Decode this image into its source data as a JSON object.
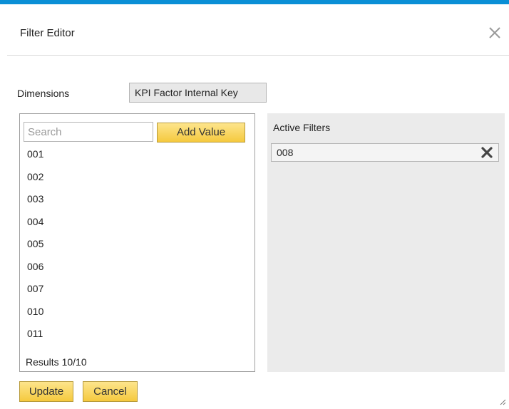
{
  "dialog": {
    "title": "Filter Editor",
    "close_icon": "close-icon"
  },
  "dimensions": {
    "label": "Dimensions",
    "selected": "KPI Factor Internal Key"
  },
  "values_panel": {
    "search_placeholder": "Search",
    "search_value": "",
    "add_button": "Add Value",
    "items": [
      "001",
      "002",
      "003",
      "004",
      "005",
      "006",
      "007",
      "010",
      "011"
    ],
    "results": "Results 10/10"
  },
  "active_filters": {
    "label": "Active Filters",
    "items": [
      {
        "value": "008",
        "remove_icon": "remove-x-icon"
      }
    ]
  },
  "footer": {
    "update_button": "Update",
    "cancel_button": "Cancel"
  },
  "colors": {
    "accent_bar": "#0a8fd6",
    "button_yellow": "#f5c93e",
    "panel_gray": "#ebebeb"
  }
}
